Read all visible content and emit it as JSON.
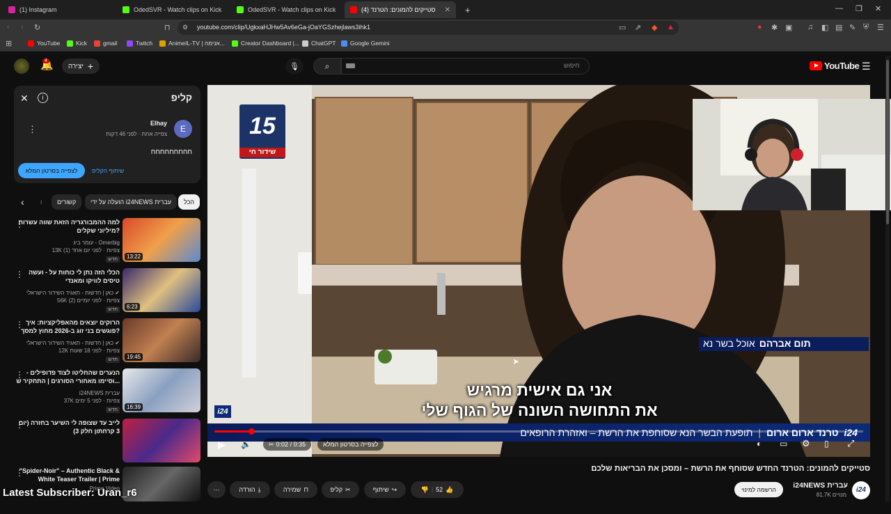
{
  "browser": {
    "tabs": [
      {
        "label": "(1) Instagram",
        "favicon": "instagram-icon",
        "color": "#d6249f"
      },
      {
        "label": "OdedSVR - Watch clips on Kick",
        "favicon": "kick-icon",
        "color": "#53fc18"
      },
      {
        "label": "OdedSVR - Watch clips on Kick",
        "favicon": "kick-icon",
        "color": "#53fc18"
      },
      {
        "label": "סטייקים להמונים: הטרנד (4)",
        "favicon": "youtube-icon",
        "color": "#ff0000"
      }
    ],
    "new_tab": "+",
    "url": "youtube.com/clip/UgkxaHJHw5Av6eGa-jOaYGSzhejlaws3ihk1",
    "bookmarks": [
      {
        "label": "YouTube",
        "color": "#ff0000"
      },
      {
        "label": "Kick",
        "color": "#53fc18"
      },
      {
        "label": "gmail",
        "color": "#ea4335"
      },
      {
        "label": "Twitch",
        "color": "#9146ff"
      },
      {
        "label": "AnimeIL-TV | אנימה...",
        "color": "#e0a000"
      },
      {
        "label": "Creator Dashboard |...",
        "color": "#53fc18"
      },
      {
        "label": "ChatGPT",
        "color": "#cccccc"
      },
      {
        "label": "Google Gemini",
        "color": "#4b8cf5"
      }
    ]
  },
  "yt_header": {
    "logo": "YouTube",
    "search_placeholder": "חיפוש",
    "create_label": "יצירה",
    "notif_count": "4"
  },
  "clip_panel": {
    "title": "קליפ",
    "author": "Elhay",
    "author_initial": "E",
    "meta": "צפייה אחת · לפני 46 דקות",
    "clip_text": "חחחחחחחחח",
    "share_label": "שיתוף הקליפ",
    "watch_full_label": "לצפייה בסרטון המלא"
  },
  "chips": [
    {
      "label": "הכל"
    },
    {
      "label": "הועלה על ידי i24NEWS עברית"
    },
    {
      "label": "קשורים"
    },
    {
      "label": "ו"
    }
  ],
  "videos": [
    {
      "title": "למה ההמבורגריה הזאת שווה עשרות מיליוני שקלים?",
      "channel": "עומר ביג - Omerbig",
      "stats": "13K צפיות · לפני יום אחד (1)",
      "badge": "חדש",
      "duration": "13:22",
      "verified": false
    },
    {
      "title": "הכלי הזה נתן לי כוחות על - ועשה טיסים לוויקו ומאנדי",
      "channel": "כאן | חדשות - תאגיד השידור הישראלי",
      "stats": "56K צפיות · לפני יומיים (2)",
      "badge": "חדש",
      "duration": "6:23",
      "verified": true
    },
    {
      "title": "הרוקים יוצאים מהאפליקציות: איך פוגשים בני זוג ב-2026 מחוץ למסך?",
      "channel": "כאן | חדשות - תאגיד השידור הישראלי",
      "stats": "12K צפיות · לפני 18 שעות",
      "badge": "חדש",
      "duration": "19:45",
      "verified": true
    },
    {
      "title": "הנערים שהחליטו לצוד פדופילים - וסיימו מאחורי הסורגים | התחקיר ש...",
      "channel": "i24NEWS עברית",
      "stats": "37K צפיות · לפני 5 ימים",
      "badge": "חדש",
      "duration": "16:39",
      "verified": false
    },
    {
      "title": "לייב עד שצופה לי השיער בחזרה (יום 3 קרחתון חלק 3)",
      "channel": "",
      "stats": "",
      "badge": "",
      "duration": "",
      "verified": false
    },
    {
      "title": "\"Spider-Noir\" – Authentic Black & White Teaser Trailer | Prime",
      "channel": "Prime Video",
      "stats": "",
      "badge": "",
      "duration": "",
      "verified": false
    }
  ],
  "player": {
    "channel_logo": "15",
    "live_label": "שידור חי",
    "time": "0:02 / 0:35",
    "watch_full": "לצפייה בסרטון המלא",
    "subtitle_line1": "אני גם אישית מרגיש",
    "subtitle_line2": "את התחושה השונה של הגוף שלי",
    "name_tag_name": "תום אברהם",
    "name_tag_desc": "אוכל בשר נא",
    "ticker_brand": "i24",
    "ticker_topic": "טרנד ארום ארום",
    "ticker_text": "תופעת הבשר הנא שסוחפת את הרשת – ואזהרת הרופאים",
    "progress_fraction": 0.057
  },
  "video_info": {
    "title": "סטייקים להמונים: הטרנד החדש שסוחף את הרשת – ומסכן את הבריאות שלכם",
    "channel": "i24NEWS עברית",
    "subscribers": "81.7K מנויים",
    "subscribe_label": "הרשמה למינוי",
    "likes": "52",
    "share_label": "שיתוף",
    "clip_label": "קליפ",
    "save_label": "שמירה",
    "download_label": "הורדה"
  },
  "overlay": {
    "latest_subscriber": "Latest Subscriber: Uran_r6"
  }
}
